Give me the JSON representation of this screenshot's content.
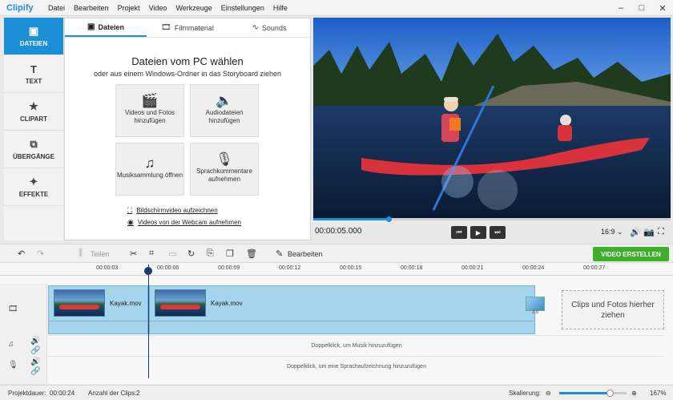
{
  "app": {
    "logo": "Clipify"
  },
  "menu": [
    "Datei",
    "Bearbeiten",
    "Projekt",
    "Video",
    "Werkzeuge",
    "Einstellungen",
    "Hilfe"
  ],
  "window_controls": {
    "minimize": "–",
    "maximize": "□",
    "close": "✕"
  },
  "sidebar": {
    "items": [
      {
        "label": "DATEIEN",
        "icon": "image-icon",
        "glyph": "▣"
      },
      {
        "label": "TEXT",
        "icon": "text-icon",
        "glyph": "T"
      },
      {
        "label": "CLIPART",
        "icon": "star-icon",
        "glyph": "★"
      },
      {
        "label": "ÜBERGÄNGE",
        "icon": "transition-icon",
        "glyph": "⧉"
      },
      {
        "label": "EFFEKTE",
        "icon": "magic-wand-icon",
        "glyph": "✦"
      }
    ]
  },
  "tabs": [
    {
      "label": "Dateien",
      "glyph": "▣"
    },
    {
      "label": "Filmmaterial",
      "glyph": "🎞"
    },
    {
      "label": "Sounds",
      "glyph": "∿"
    }
  ],
  "panel": {
    "title": "Dateien vom PC wählen",
    "subtitle": "oder aus einem Windows-Ordner in das Storyboard ziehen",
    "tiles": [
      {
        "label": "Videos und Fotos hinzufügen",
        "glyph": "🎬"
      },
      {
        "label": "Audiodateien hinzufügen",
        "glyph": "🔈"
      },
      {
        "label": "Musiksammlung öffnen",
        "glyph": "♫"
      },
      {
        "label": "Sprachkommentare aufnehmen",
        "glyph": "🎙"
      }
    ],
    "links": [
      {
        "label": "Bildschirmvideo aufzeichnen",
        "glyph": "⛶"
      },
      {
        "label": "Videos von der Webcam aufnehmen",
        "glyph": "◉"
      }
    ]
  },
  "player": {
    "timecode": "00:00:05.000",
    "progress": 0.21,
    "aspect": "16:9 ⌄",
    "buttons": {
      "prev": "⏮",
      "play": "▶",
      "next": "⏭"
    }
  },
  "toolbar": {
    "split": "Teilen",
    "edit": "Bearbeiten",
    "create": "VIDEO ERSTELLEN"
  },
  "ruler": [
    "00:00:03",
    "00:00:06",
    "00:00:09",
    "00:00:12",
    "00:00:15",
    "00:00:18",
    "00:00:21",
    "00:00:24",
    "00:00:27"
  ],
  "timeline": {
    "clips": [
      {
        "name": "Kayak.mov"
      },
      {
        "name": "Kayak.mov"
      }
    ],
    "transition_duration": "2.0",
    "drop_zone": "Clips und Fotos hierher ziehen",
    "music_hint": "Doppelklick, um Musik hinzuzufügen",
    "voice_hint": "Doppelklick, um eine Sprachaufzeichnung hinzuzufügen"
  },
  "status": {
    "duration_label": "Projektdauer:",
    "duration_value": "00:00:24",
    "clips_label": "Anzahl der Clips:",
    "clips_value": "2",
    "scale_label": "Skalierung:",
    "zoom": "167%",
    "zoom_level": 0.75
  },
  "colors": {
    "accent": "#1b8fd8",
    "create": "#3fae2a",
    "clip": "#a5d4ec"
  }
}
